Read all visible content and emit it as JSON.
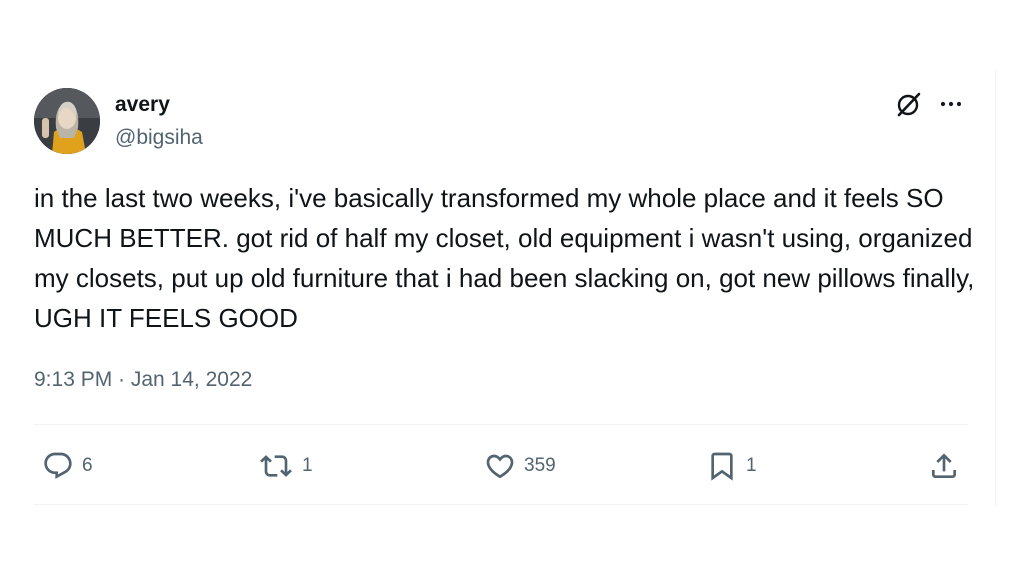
{
  "author": {
    "display_name": "avery",
    "handle": "@bigsiha"
  },
  "tweet": {
    "text": "in the last two weeks, i've basically transformed my whole place and it feels SO MUCH BETTER. got rid of half my closet, old equipment i wasn't using, organized my closets, put up old furniture that i had been slacking on, got new pillows finally, UGH IT FEELS GOOD",
    "timestamp": "9:13 PM · Jan 14, 2022"
  },
  "actions": {
    "replies": "6",
    "reposts": "1",
    "likes": "359",
    "bookmarks": "1"
  },
  "icons": {
    "top": [
      "grok-icon",
      "more-icon"
    ],
    "bottom": [
      "reply-icon",
      "repost-icon",
      "like-icon",
      "bookmark-icon",
      "share-icon"
    ]
  },
  "colors": {
    "text": "#0f1419",
    "secondary": "#536471",
    "divider": "#eff3f4"
  }
}
